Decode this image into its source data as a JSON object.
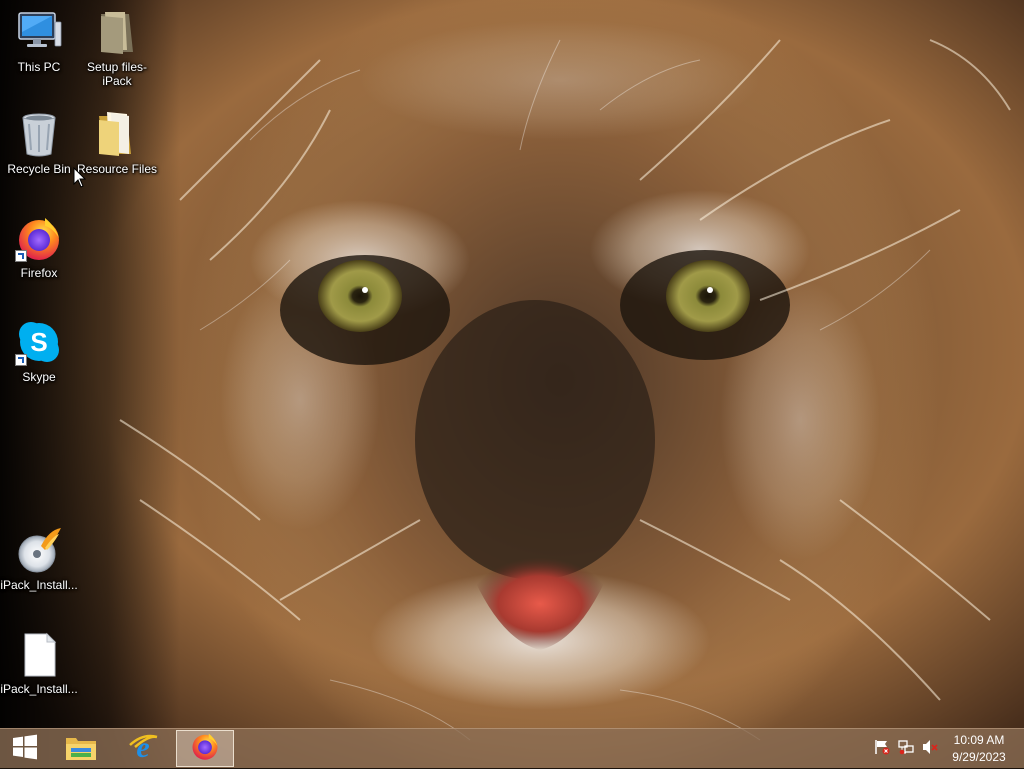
{
  "desktop": {
    "icons": [
      {
        "label": "This PC",
        "icon": "this-pc-icon"
      },
      {
        "label": "Setup files-iPack",
        "icon": "folder-icon"
      },
      {
        "label": "Recycle Bin",
        "icon": "recycle-bin-icon"
      },
      {
        "label": "Resource Files",
        "icon": "folder-icon"
      },
      {
        "label": "Firefox",
        "icon": "firefox-icon"
      },
      {
        "label": "Skype",
        "icon": "skype-icon"
      },
      {
        "label": "iPack_Install...",
        "icon": "ipack-installer-icon"
      },
      {
        "label": "iPack_Install...",
        "icon": "blank-file-icon"
      }
    ]
  },
  "taskbar": {
    "start": {
      "icon": "windows-logo-icon"
    },
    "pinned": [
      {
        "name": "File Explorer",
        "icon": "file-explorer-icon"
      },
      {
        "name": "Internet Explorer",
        "icon": "internet-explorer-icon"
      },
      {
        "name": "Firefox",
        "icon": "firefox-icon",
        "active": true
      }
    ],
    "tray": {
      "icons": [
        "action-center-flag-icon",
        "network-icon",
        "volume-muted-icon"
      ],
      "time": "10:09 AM",
      "date": "9/29/2023"
    }
  },
  "colors": {
    "taskbar": "#8c6e55",
    "folder": "#e8c86a",
    "skype": "#00aff0",
    "ie": "#1e90e8"
  }
}
